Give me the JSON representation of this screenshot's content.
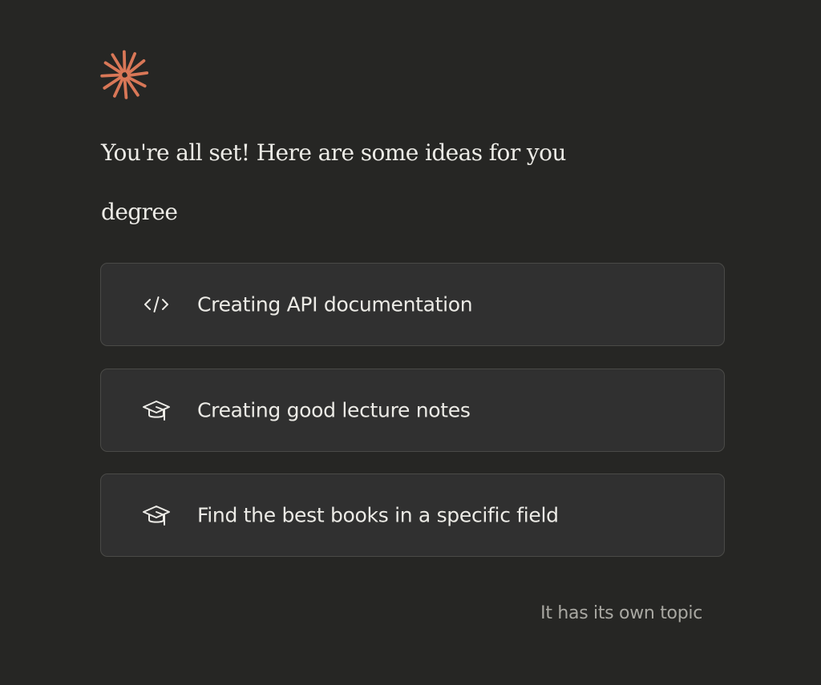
{
  "brand": {
    "logo_icon": "sparkle-burst-icon",
    "accent_color": "#D97757"
  },
  "greeting": {
    "title": "You're all set! Here are some ideas for you",
    "topic": "degree"
  },
  "suggestions": [
    {
      "icon": "code-brackets-icon",
      "label": "Creating API documentation"
    },
    {
      "icon": "graduation-cap-icon",
      "label": "Creating good lecture notes"
    },
    {
      "icon": "graduation-cap-icon",
      "label": "Find the best books in a specific field"
    }
  ],
  "footer": {
    "link_label": "It has its own topic"
  },
  "colors": {
    "background": "#262624",
    "card_background": "#303030",
    "card_border": "#4A4A47",
    "text_primary": "#ECEBE6",
    "text_secondary": "#A9A8A2"
  }
}
